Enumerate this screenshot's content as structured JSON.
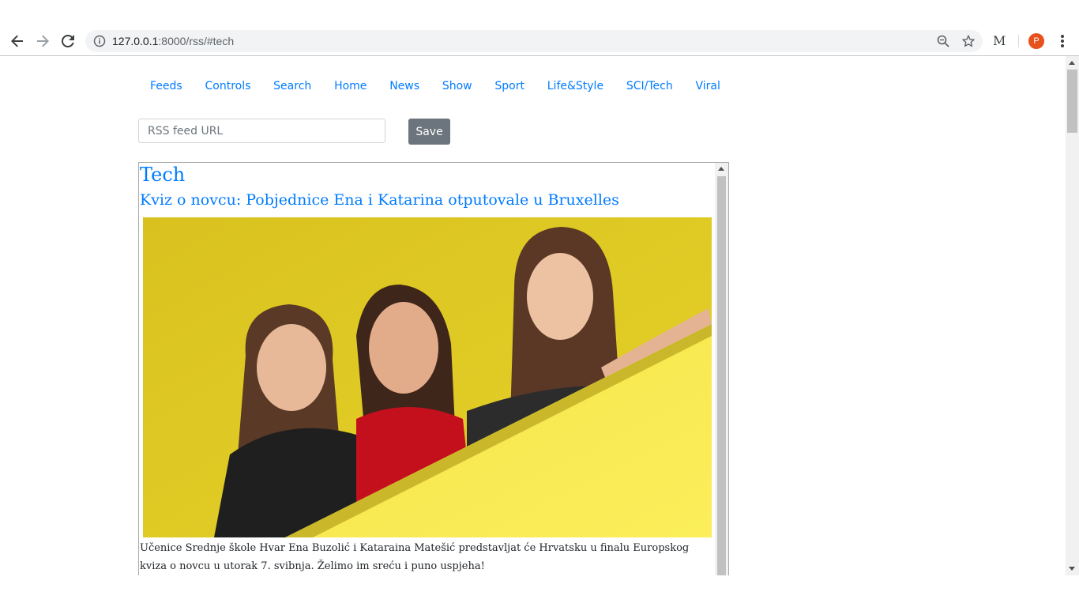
{
  "browser": {
    "url_host": "127.0.0.1",
    "url_rest": ":8000/rss/#tech",
    "extension_label": "M",
    "profile_initial": "P"
  },
  "nav": {
    "items": [
      "Feeds",
      "Controls",
      "Search",
      "Home",
      "News",
      "Show",
      "Sport",
      "Life&Style",
      "SCI/Tech",
      "Viral"
    ]
  },
  "feed_form": {
    "placeholder": "RSS feed URL",
    "save_label": "Save"
  },
  "feed": {
    "section_title": "Tech",
    "article_title": "Kviz o novcu: Pobjednice Ena i Katarina otputovale u Bruxelles",
    "article_description": "Učenice Srednje škole Hvar Ena Buzolić i Kataraina Matešić predstavljat će Hrvatsku u finalu Europskog kviza o novcu u utorak 7. svibnja. Želimo im sreću i puno uspjeha!"
  },
  "colors": {
    "link": "#007bff",
    "save_button": "#6c757d",
    "photo_background": "#d9c21f"
  }
}
